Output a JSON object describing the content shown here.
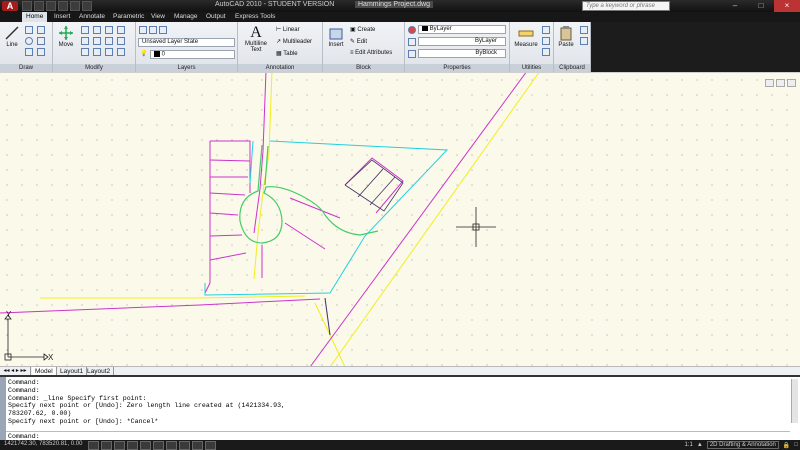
{
  "titlebar": {
    "app_menu": "A",
    "title": "AutoCAD 2010 - STUDENT VERSION",
    "file": "Hammings Project.dwg",
    "search_placeholder": "Type a keyword or phrase"
  },
  "tabs": [
    "Home",
    "Insert",
    "Annotate",
    "Parametric",
    "View",
    "Manage",
    "Output",
    "Express Tools"
  ],
  "ribbon": {
    "draw": {
      "label": "Draw",
      "line": "Line"
    },
    "modify": {
      "label": "Modify",
      "move": "Move"
    },
    "layers": {
      "label": "Layers",
      "layer_state": "Unsaved Layer State",
      "current_layer": "0"
    },
    "annotation": {
      "label": "Annotation",
      "multiline_text": "Multiline Text",
      "linear": "Linear",
      "multileader": "Multileader",
      "table": "Table"
    },
    "block": {
      "label": "Block",
      "insert": "Insert",
      "create": "Create",
      "edit": "Edit",
      "edit_attributes": "Edit Attributes"
    },
    "properties": {
      "label": "Properties",
      "color": "ByLayer",
      "linetype": "ByLayer",
      "lineweight": "ByBlock"
    },
    "utilities": {
      "label": "Utilities",
      "measure": "Measure"
    },
    "clipboard": {
      "label": "Clipboard",
      "paste": "Paste"
    }
  },
  "ucs": {
    "x": "X",
    "y": "Y"
  },
  "layout_tabs": [
    "Model",
    "Layout1",
    "Layout2"
  ],
  "command_lines": [
    "Command:",
    "Command:",
    "Command: _line Specify first point:",
    "Specify next point or [Undo]: Zero length line created at (1421334.93,",
    "783207.62, 0.00)",
    "Specify next point or [Undo]: *Cancel*"
  ],
  "command_prompt": "Command:",
  "status": {
    "coordinates": "1421742.30, 783520.81, 0.00",
    "scale": "1:1",
    "workspace": "2D Drafting & Annotation"
  },
  "colors": {
    "canvas": "#fbf9ea",
    "magenta": "#cc33cc",
    "cyan": "#22d0e0",
    "green": "#44cc66",
    "yellow": "#f0ee20",
    "dark": "#403060"
  }
}
